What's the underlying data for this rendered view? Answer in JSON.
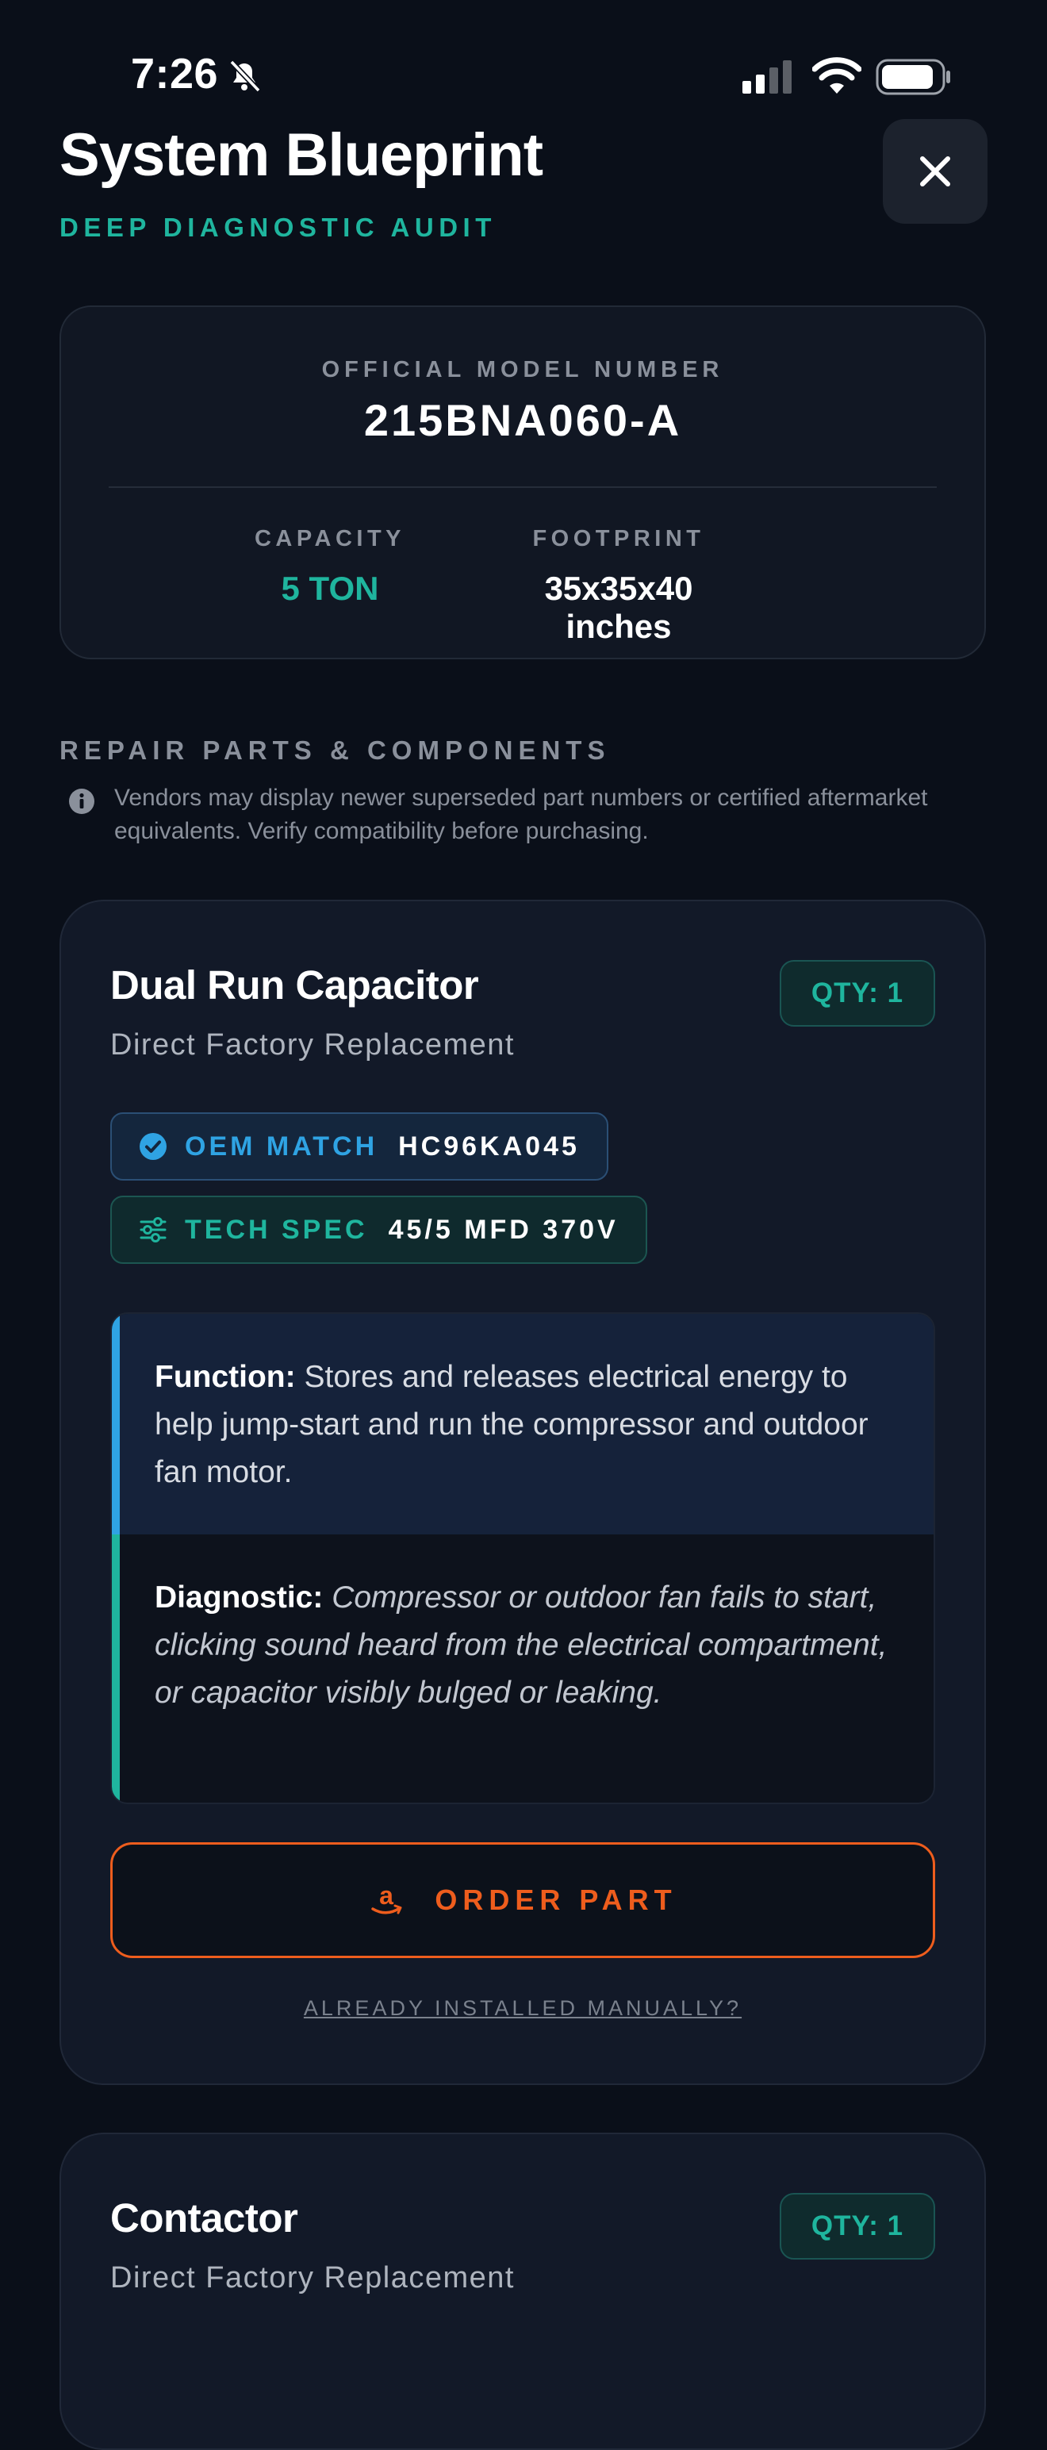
{
  "status_bar": {
    "time": "7:26"
  },
  "header": {
    "title": "System Blueprint",
    "subtitle": "DEEP DIAGNOSTIC AUDIT"
  },
  "model": {
    "label": "OFFICIAL MODEL NUMBER",
    "number": "215BNA060-A",
    "capacity_label": "CAPACITY",
    "capacity_value": "5 TON",
    "footprint_label": "FOOTPRINT",
    "footprint_value": "35x35x40 inches"
  },
  "parts_section": {
    "title": "REPAIR PARTS & COMPONENTS",
    "note": "Vendors may display newer superseded part numbers or certified aftermarket equivalents. Verify compatibility before purchasing."
  },
  "parts": [
    {
      "name": "Dual Run Capacitor",
      "subtitle": "Direct Factory Replacement",
      "qty": "QTY: 1",
      "oem_label": "OEM MATCH",
      "oem_value": "HC96KA045",
      "tech_label": "TECH SPEC",
      "tech_value": "45/5 MFD 370V",
      "function_label": "Function:",
      "function_text": "Stores and releases electrical energy to help jump-start and run the compressor and outdoor fan motor.",
      "diagnostic_label": "Diagnostic:",
      "diagnostic_text": "Compressor or outdoor fan fails to start, clicking sound heard from the electrical compartment, or capacitor visibly bulged or leaking.",
      "order_label": "ORDER PART",
      "installed_link": "ALREADY INSTALLED MANUALLY?"
    },
    {
      "name": "Contactor",
      "subtitle": "Direct Factory Replacement",
      "qty": "QTY: 1"
    }
  ],
  "colors": {
    "background": "#0a0f19",
    "accent_teal": "#1fb59e",
    "accent_blue": "#2fa3e3",
    "accent_orange": "#ee5d1d"
  },
  "icons": {
    "close": "close-icon",
    "info": "info-icon",
    "oem": "check-circle-icon",
    "tech": "sliders-icon",
    "order": "amazon-icon"
  }
}
